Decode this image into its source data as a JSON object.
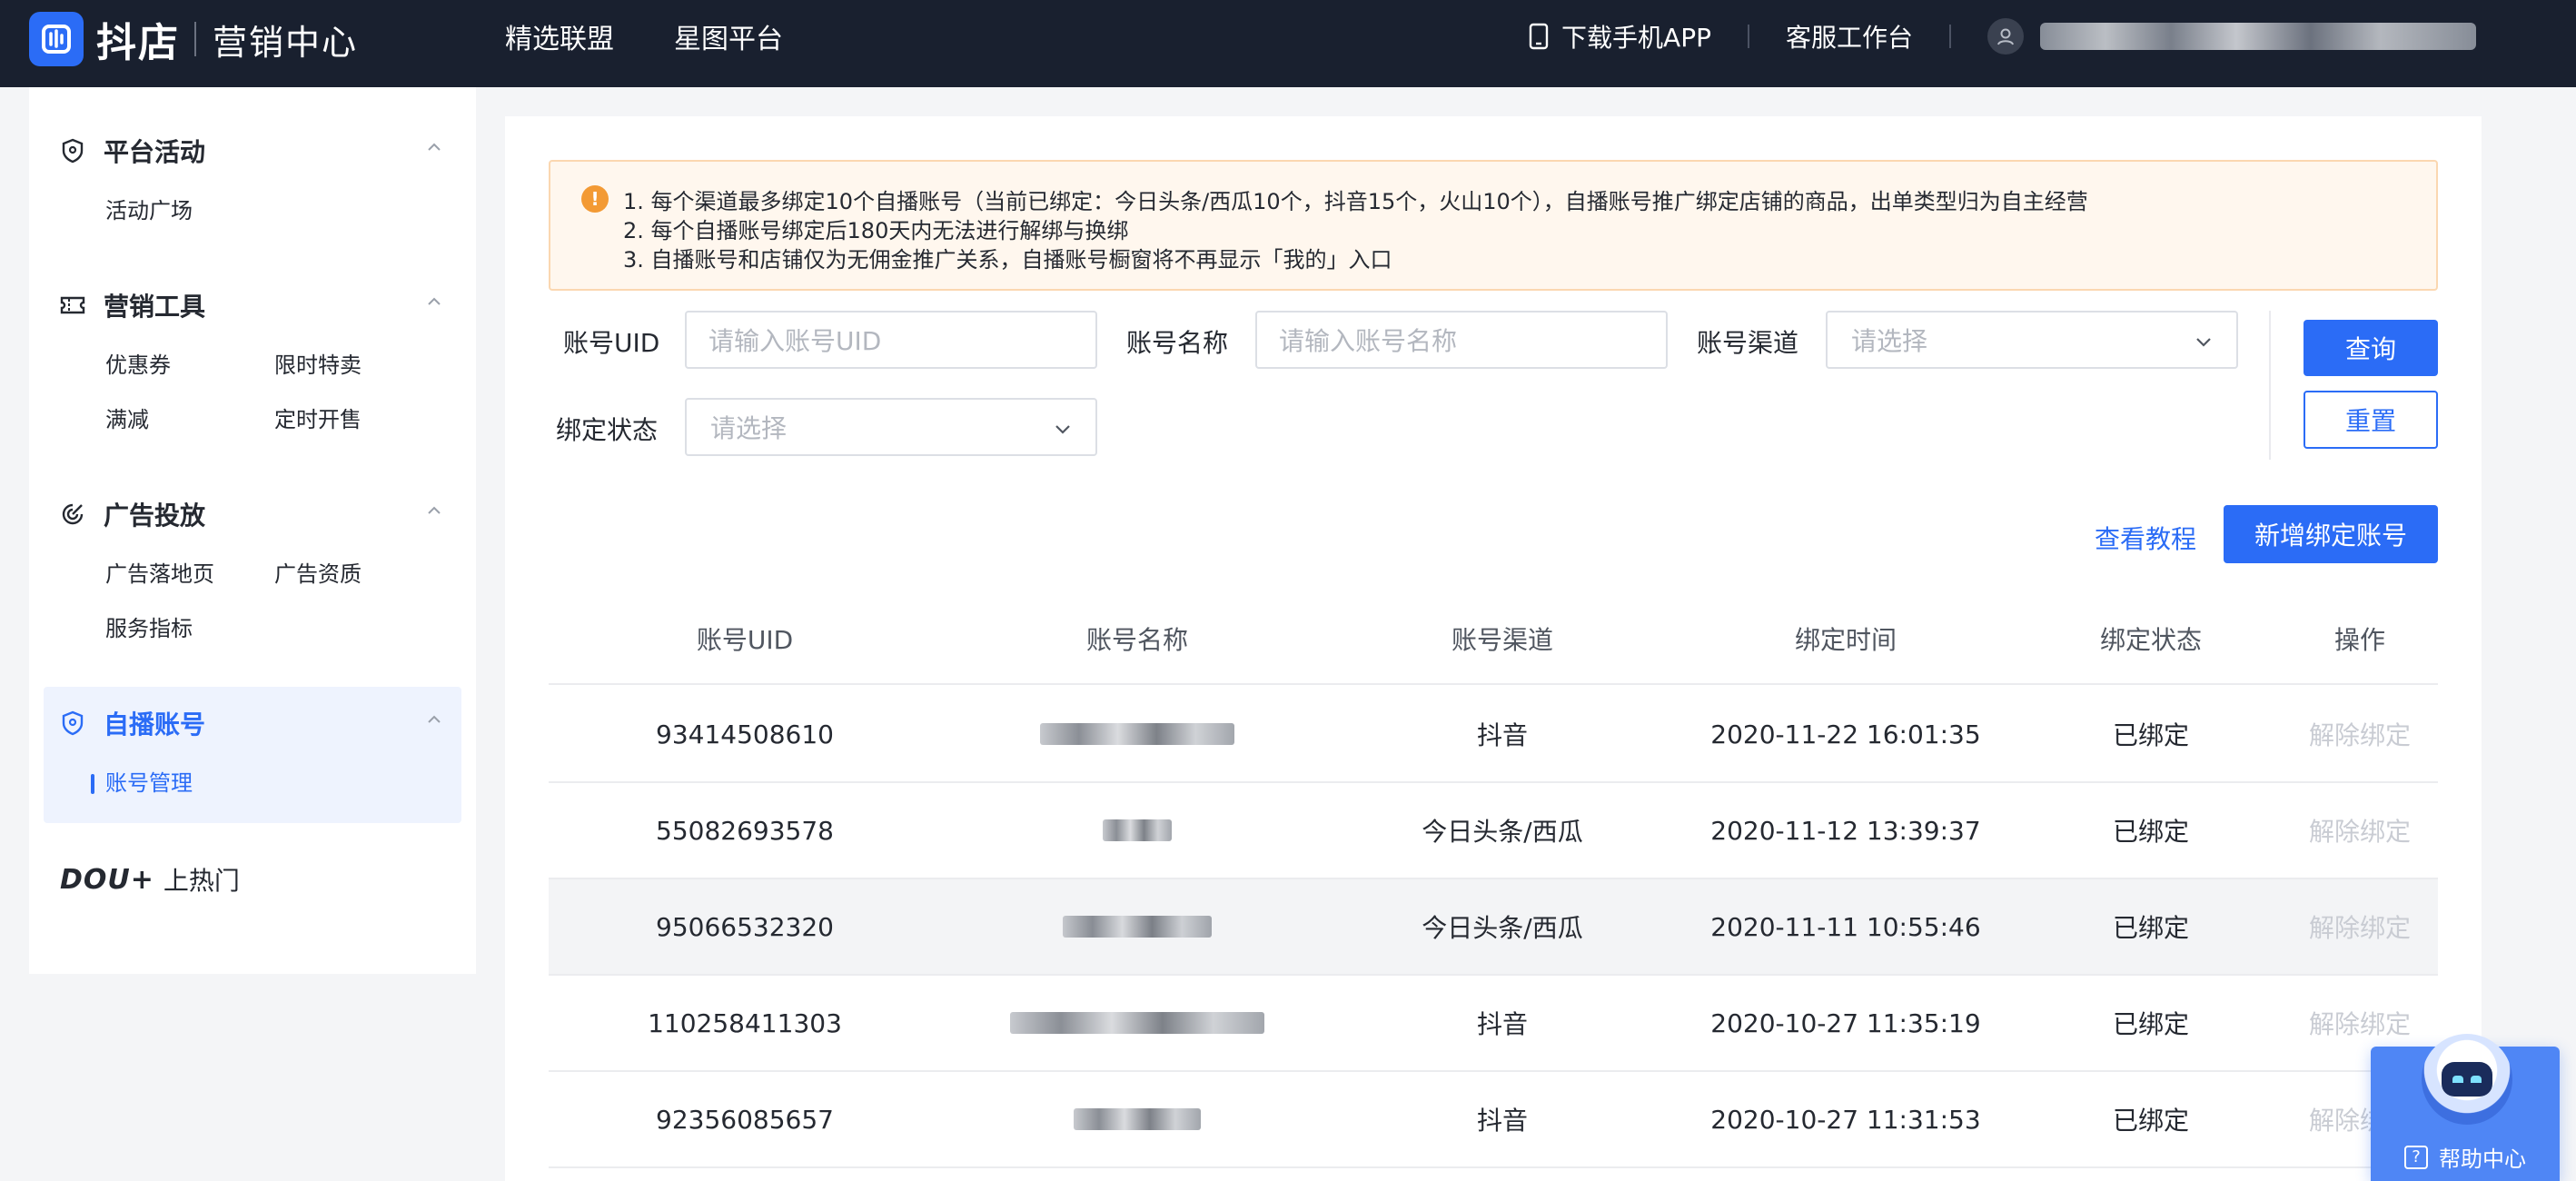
{
  "header": {
    "brand": "抖店",
    "brand_sub": "营销中心",
    "nav": [
      "精选联盟",
      "星图平台"
    ],
    "download_app": "下载手机APP",
    "service_desk": "客服工作台"
  },
  "sidebar": {
    "groups": [
      {
        "title": "平台活动",
        "icon": "shield-icon",
        "items": [
          "活动广场"
        ]
      },
      {
        "title": "营销工具",
        "icon": "ticket-icon",
        "items": [
          "优惠券",
          "限时特卖",
          "满减",
          "定时开售"
        ]
      },
      {
        "title": "广告投放",
        "icon": "target-icon",
        "items": [
          "广告落地页",
          "广告资质",
          "服务指标"
        ]
      },
      {
        "title": "自播账号",
        "icon": "shield-icon",
        "items": [
          "账号管理"
        ]
      }
    ],
    "douplus_logo": "DOU+",
    "douplus_label": "上热门"
  },
  "notice": {
    "lines": [
      "1. 每个渠道最多绑定10个自播账号（当前已绑定：今日头条/西瓜10个，抖音15个，火山10个），自播账号推广绑定店铺的商品，出单类型归为自主经营",
      "2. 每个自播账号绑定后180天内无法进行解绑与换绑",
      "3. 自播账号和店铺仅为无佣金推广关系，自播账号橱窗将不再显示「我的」入口"
    ]
  },
  "filters": {
    "uid_label": "账号UID",
    "uid_placeholder": "请输入账号UID",
    "name_label": "账号名称",
    "name_placeholder": "请输入账号名称",
    "channel_label": "账号渠道",
    "channel_placeholder": "请选择",
    "status_label": "绑定状态",
    "status_placeholder": "请选择",
    "query": "查询",
    "reset": "重置"
  },
  "actions": {
    "tutorial": "查看教程",
    "add": "新增绑定账号"
  },
  "table": {
    "columns": [
      "账号UID",
      "账号名称",
      "账号渠道",
      "绑定时间",
      "绑定状态",
      "操作"
    ],
    "rows": [
      {
        "uid": "93414508610",
        "channel": "抖音",
        "time": "2020-11-22 16:01:35",
        "status": "已绑定",
        "op": "解除绑定"
      },
      {
        "uid": "55082693578",
        "channel": "今日头条/西瓜",
        "time": "2020-11-12 13:39:37",
        "status": "已绑定",
        "op": "解除绑定"
      },
      {
        "uid": "95066532320",
        "channel": "今日头条/西瓜",
        "time": "2020-11-11 10:55:46",
        "status": "已绑定",
        "op": "解除绑定"
      },
      {
        "uid": "110258411303",
        "channel": "抖音",
        "time": "2020-10-27 11:35:19",
        "status": "已绑定",
        "op": "解除绑定"
      },
      {
        "uid": "92356085657",
        "channel": "抖音",
        "time": "2020-10-27 11:31:53",
        "status": "已绑定",
        "op": "解除绑定"
      }
    ]
  },
  "help": {
    "label": "帮助中心"
  },
  "colors": {
    "primary": "#2b6cf6",
    "topbar": "#19202f",
    "warning": "#f39a34"
  }
}
